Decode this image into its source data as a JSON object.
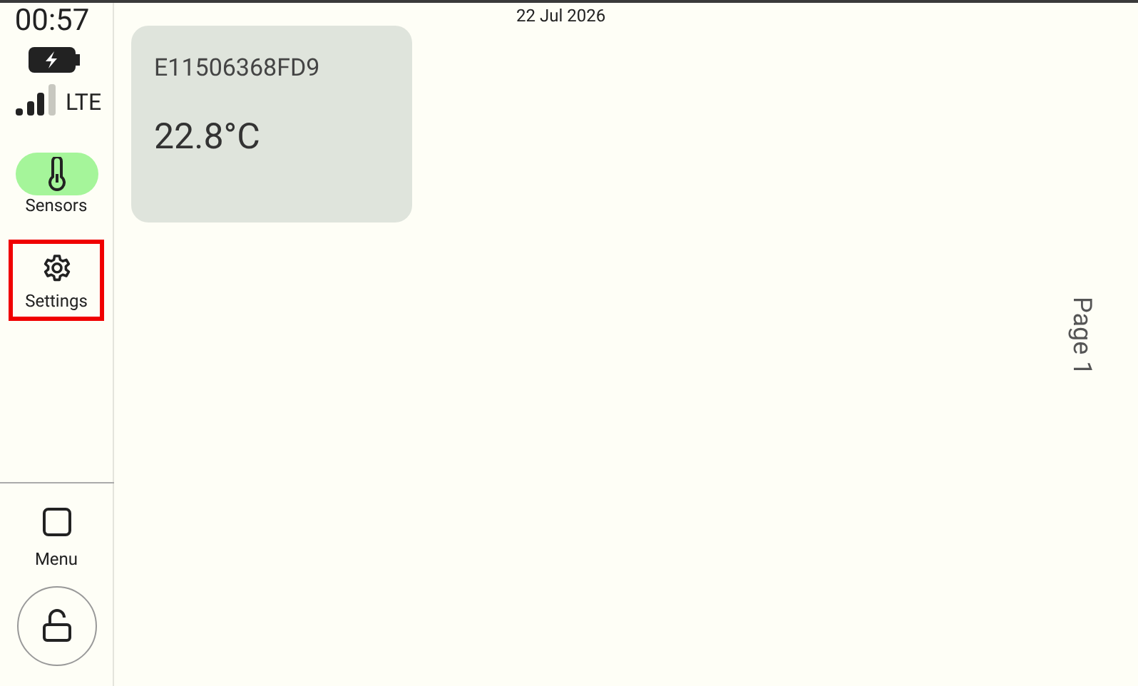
{
  "status": {
    "time": "00:57",
    "charging": true,
    "network": "LTE"
  },
  "date": "22 Jul 2026",
  "nav": [
    {
      "kind": "sensors",
      "label": "Sensors",
      "selected": true,
      "highlighted": false
    },
    {
      "kind": "settings",
      "label": "Settings",
      "selected": false,
      "highlighted": true
    }
  ],
  "menu": {
    "label": "Menu"
  },
  "lock": {
    "locked": false
  },
  "sensor_cards": [
    {
      "id": "E11506368FD9",
      "temperature": "22.8°C"
    }
  ],
  "page_indicator": "Page 1"
}
